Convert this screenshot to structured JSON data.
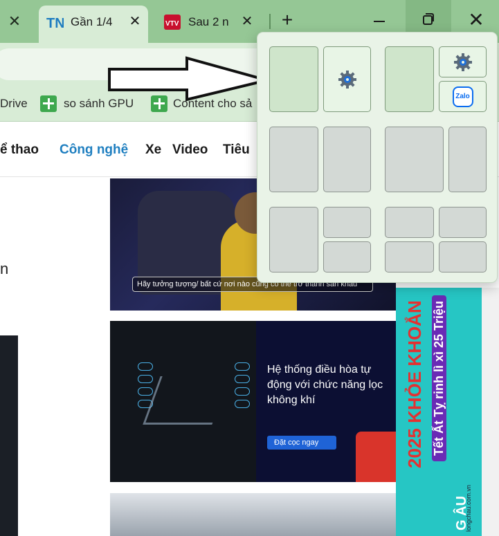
{
  "tabs": [
    {
      "title": "Gần 1/4",
      "favicon": "thanhnien-logo",
      "active": true
    },
    {
      "title": "Sau 2 n",
      "favicon": "vtv-logo",
      "active": false
    }
  ],
  "bookmarks": [
    {
      "label": "Drive"
    },
    {
      "label": "so sánh GPU"
    },
    {
      "label": "Content cho sả"
    }
  ],
  "nav": {
    "items": [
      {
        "label": "ể thao",
        "active": false
      },
      {
        "label": "Công nghệ",
        "active": true
      },
      {
        "label": "Xe",
        "active": false
      },
      {
        "label": "Video",
        "active": false
      },
      {
        "label": "Tiêu",
        "active": false
      }
    ]
  },
  "article": {
    "fragment": "n"
  },
  "cards": [
    {
      "caption": "Hãy tưởng tượng/  bất cứ nơi nào cũng có thể trở thành sân khấu"
    },
    {
      "title": "Hệ thống điều hòa tự động với chức năng lọc không khí",
      "cta": "Đặt cọc ngay"
    }
  ],
  "ad": {
    "line1": "2025 KHỎE KHOẮN",
    "line2": "Tết Ất Tỵ rinh lì xì 25 Triệu",
    "line3": "G ÂU",
    "url": "longchau.com.vn"
  },
  "snap": {
    "icons": {
      "settings": "gear-icon",
      "zalo": "zalo-icon"
    },
    "zalo_label": "Zalo"
  },
  "colors": {
    "tabstrip": "#95c795",
    "toolbar": "#d8ecd6",
    "link_active": "#1f7fc0",
    "ad_bg": "#26c6c4",
    "snap_bg": "#e9f3e7"
  }
}
